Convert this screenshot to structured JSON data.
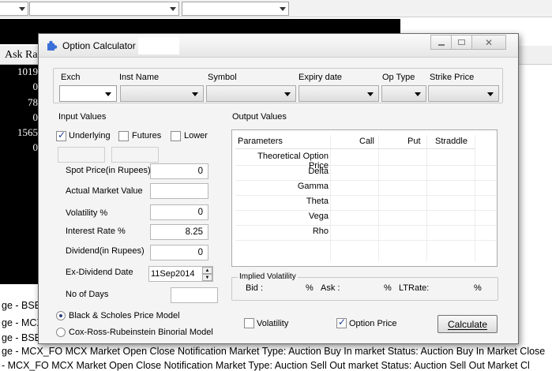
{
  "background": {
    "column_header": "Ask Ra",
    "values": [
      "1019",
      "0",
      "78",
      "0",
      "1565",
      "0"
    ],
    "messages": [
      "ge - BSE_",
      "ge - MCX",
      "ge - BSE",
      "ge - MCX_FO MCX Market Open Close Notification Market Type: Auction Buy In market  Status: Auction Buy In Market Close",
      "- MCX_FO MCX Market Open Close Notification Market Type: Auction Sell Out market  Status: Auction Sell Out Market Cl"
    ]
  },
  "dialog": {
    "title": "Option Calculator",
    "selectors": {
      "exch_label": "Exch",
      "inst_name_label": "Inst Name",
      "symbol_label": "Symbol",
      "expiry_label": "Expiry date",
      "op_type_label": "Op Type",
      "strike_label": "Strike Price"
    },
    "input_values": {
      "title": "Input Values",
      "underlying_label": "Underlying",
      "underlying_checked": true,
      "futures_label": "Futures",
      "futures_checked": false,
      "lower_label": "Lower",
      "lower_checked": false,
      "spot_label": "Spot Price(in Rupees)",
      "spot_value": "0",
      "actual_market_label": "Actual Market Value",
      "actual_market_value": "",
      "volatility_label": "Volatility %",
      "volatility_value": "0",
      "interest_label": "Interest Rate %",
      "interest_value": "8.25",
      "dividend_label": "Dividend(in Rupees)",
      "dividend_value": "0",
      "ex_dividend_label": "Ex-Dividend Date",
      "ex_dividend_value": "11Sep2014",
      "no_of_days_label": "No of Days",
      "no_of_days_value": "",
      "model_bs_label": "Black & Scholes Price Model",
      "model_crr_label": "Cox-Ross-Rubeinstein Binorial Model",
      "selected_model": "bs"
    },
    "output_values": {
      "title": "Output Values",
      "columns": [
        "Parameters",
        "Call",
        "Put",
        "Straddle"
      ],
      "rows": [
        "Theoretical Option Price",
        "Delta",
        "Gamma",
        "Theta",
        "Vega",
        "Rho"
      ]
    },
    "implied_volatility": {
      "title": "Implied Volatility",
      "bid_label": "Bid :",
      "bid_unit": "%",
      "ask_label": "Ask :",
      "ask_unit": "%",
      "ltrate_label": "LTRate:",
      "ltrate_unit": "%"
    },
    "bottom": {
      "volatility_label": "Volatility",
      "volatility_checked": false,
      "option_price_label": "Option Price",
      "option_price_checked": true,
      "calculate_label": "Calculate"
    },
    "colors": {
      "accent_blue": "#3a6fd8",
      "check_blue": "#1e3e9a"
    }
  }
}
